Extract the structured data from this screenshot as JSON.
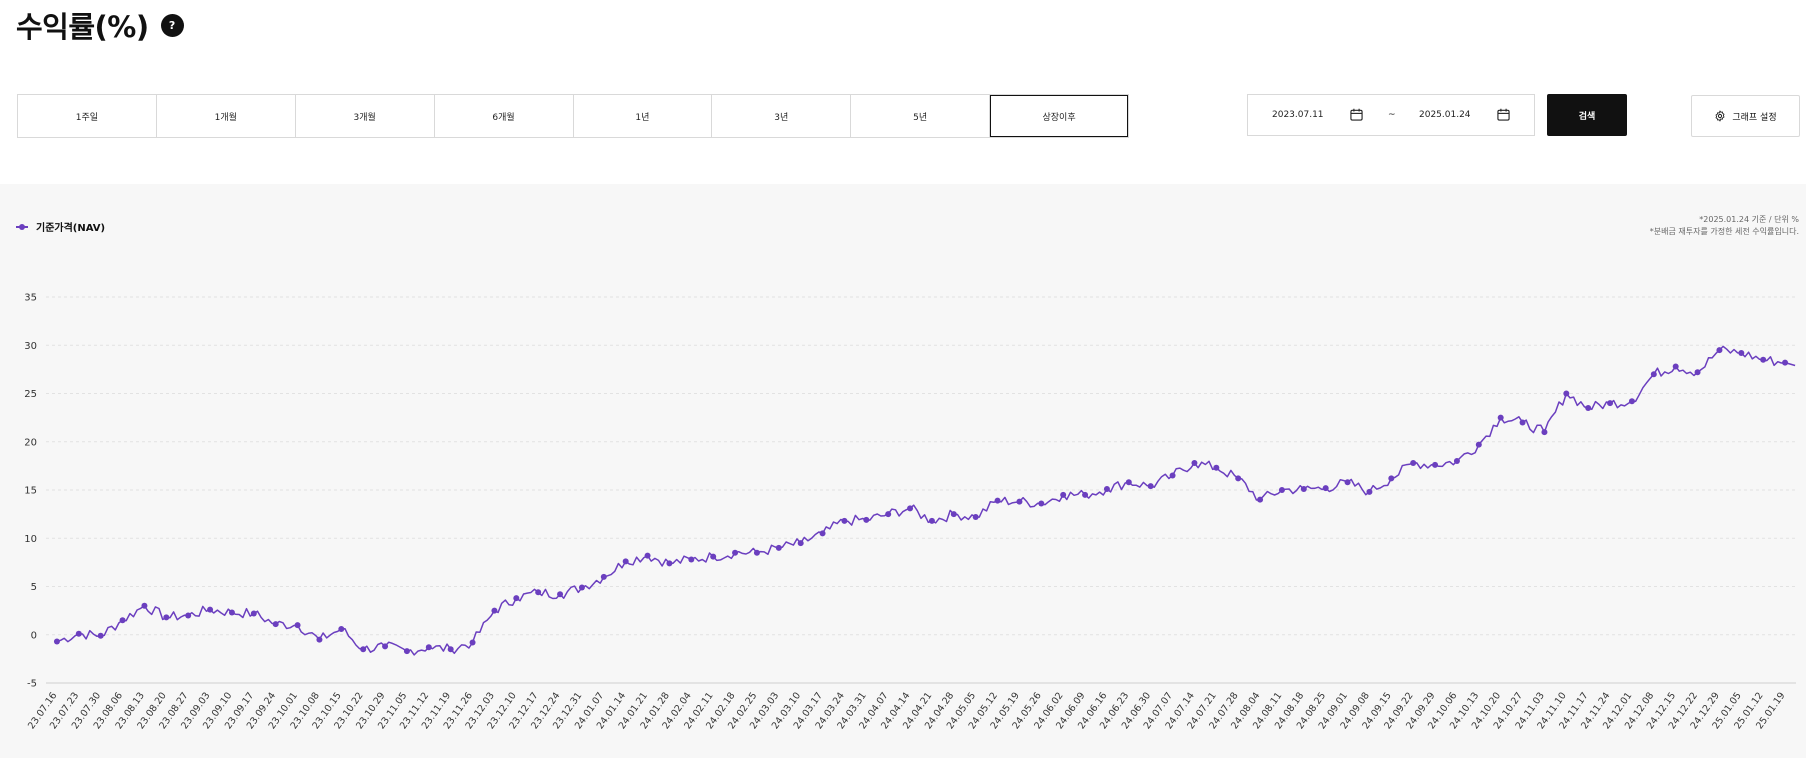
{
  "header": {
    "title": "수익률(%)",
    "help_label": "?"
  },
  "periods": [
    "1주일",
    "1개월",
    "3개월",
    "6개월",
    "1년",
    "3년",
    "5년",
    "상장이후"
  ],
  "active_period": "상장이후",
  "date_range": {
    "start": "2023.07.11",
    "separator": "~",
    "end": "2025.01.24"
  },
  "search_label": "검색",
  "settings_label": "그래프 설정",
  "notes": {
    "basis": "*2025.01.24 기준 / 단위 %",
    "reinvest": "*분배금 재투자를 가정한 세전 수익률입니다."
  },
  "colors": {
    "series": "#6b3fbf",
    "grid": "#e2e2e2"
  },
  "chart_data": {
    "type": "line",
    "title": "",
    "xlabel": "",
    "ylabel": "",
    "ylim": [
      -5,
      35
    ],
    "yticks": [
      -5,
      0,
      5,
      10,
      15,
      20,
      25,
      30,
      35
    ],
    "grid": true,
    "legend_position": "top-left",
    "x": [
      "23.07.16",
      "23.07.23",
      "23.07.30",
      "23.08.06",
      "23.08.13",
      "23.08.20",
      "23.08.27",
      "23.09.03",
      "23.09.10",
      "23.09.17",
      "23.09.24",
      "23.10.01",
      "23.10.08",
      "23.10.15",
      "23.10.22",
      "23.10.29",
      "23.11.05",
      "23.11.12",
      "23.11.19",
      "23.11.26",
      "23.12.03",
      "23.12.10",
      "23.12.17",
      "23.12.24",
      "23.12.31",
      "24.01.07",
      "24.01.14",
      "24.01.21",
      "24.01.28",
      "24.02.04",
      "24.02.11",
      "24.02.18",
      "24.02.25",
      "24.03.03",
      "24.03.10",
      "24.03.17",
      "24.03.24",
      "24.03.31",
      "24.04.07",
      "24.04.14",
      "24.04.21",
      "24.04.28",
      "24.05.05",
      "24.05.12",
      "24.05.19",
      "24.05.26",
      "24.06.02",
      "24.06.09",
      "24.06.16",
      "24.06.23",
      "24.06.30",
      "24.07.07",
      "24.07.14",
      "24.07.21",
      "24.07.28",
      "24.08.04",
      "24.08.11",
      "24.08.18",
      "24.08.25",
      "24.09.01",
      "24.09.08",
      "24.09.15",
      "24.09.22",
      "24.09.29",
      "24.10.06",
      "24.10.13",
      "24.10.20",
      "24.10.27",
      "24.11.03",
      "24.11.10",
      "24.11.17",
      "24.11.24",
      "24.12.01",
      "24.12.08",
      "24.12.15",
      "24.12.22",
      "24.12.29",
      "25.01.05",
      "25.01.12",
      "25.01.19"
    ],
    "series": [
      {
        "name": "기준가격(NAV)",
        "values": [
          -0.7,
          0.1,
          -0.1,
          1.5,
          3.0,
          1.8,
          2.0,
          2.6,
          2.3,
          2.2,
          1.1,
          1.0,
          -0.5,
          0.6,
          -1.5,
          -1.2,
          -1.7,
          -1.3,
          -1.5,
          -0.8,
          2.5,
          3.8,
          4.4,
          4.2,
          4.9,
          6.0,
          7.6,
          8.2,
          7.4,
          7.8,
          8.1,
          8.5,
          8.5,
          9.0,
          9.5,
          10.5,
          11.8,
          11.9,
          12.5,
          13.1,
          11.8,
          12.5,
          12.2,
          13.9,
          13.8,
          13.6,
          14.5,
          14.5,
          15.1,
          15.8,
          15.4,
          16.5,
          17.8,
          17.3,
          16.2,
          14.0,
          15.0,
          15.1,
          15.2,
          15.8,
          14.8,
          16.2,
          17.8,
          17.6,
          18.0,
          19.7,
          22.5,
          22.0,
          21.0,
          25.0,
          23.5,
          24.0,
          24.2,
          27.0,
          27.8,
          27.2,
          29.5,
          29.2,
          28.5,
          28.2
        ]
      }
    ]
  }
}
